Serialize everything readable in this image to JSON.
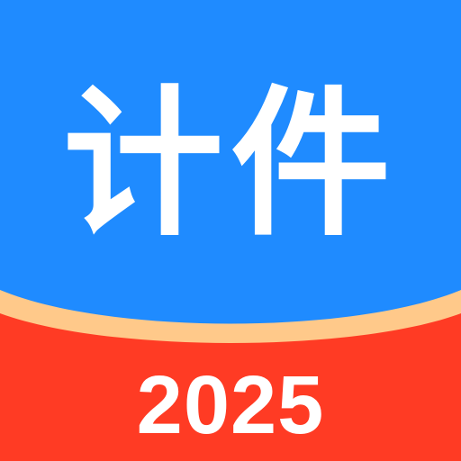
{
  "app_icon": {
    "title": "计件",
    "year": "2025"
  },
  "colors": {
    "top_blue": "#1f8bff",
    "band_peach": "#ffc98a",
    "bottom_red": "#ff3b24",
    "text_white": "#ffffff"
  }
}
